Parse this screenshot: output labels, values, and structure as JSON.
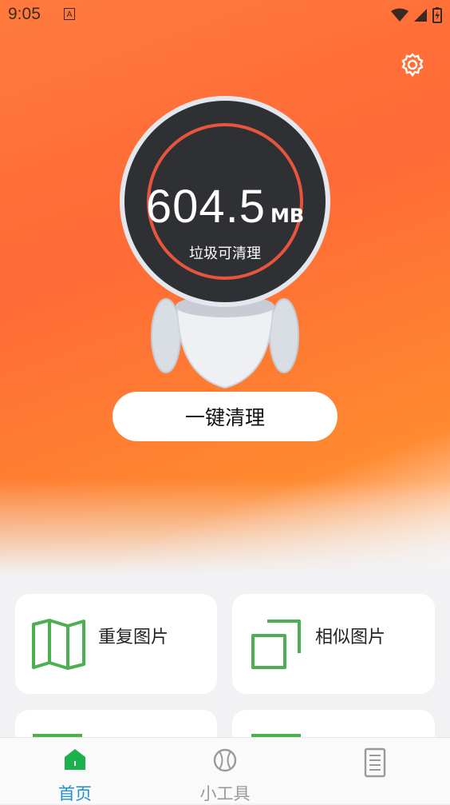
{
  "status_bar": {
    "time": "9:05",
    "notification": "A"
  },
  "gauge": {
    "size_value": "604.5",
    "size_unit": "MB",
    "caption": "垃圾可清理"
  },
  "actions": {
    "clean_button": "一键清理"
  },
  "tools": [
    {
      "label": "重复图片",
      "icon": "map-icon"
    },
    {
      "label": "相似图片",
      "icon": "copy-icon"
    }
  ],
  "tabs": [
    {
      "label": "首页",
      "active": true
    },
    {
      "label": "小工具",
      "active": false
    },
    {
      "label": "",
      "active": false
    }
  ],
  "colors": {
    "accent": "#ff6a36",
    "green": "#4caf50",
    "active_tab": "#1e8fd6"
  }
}
